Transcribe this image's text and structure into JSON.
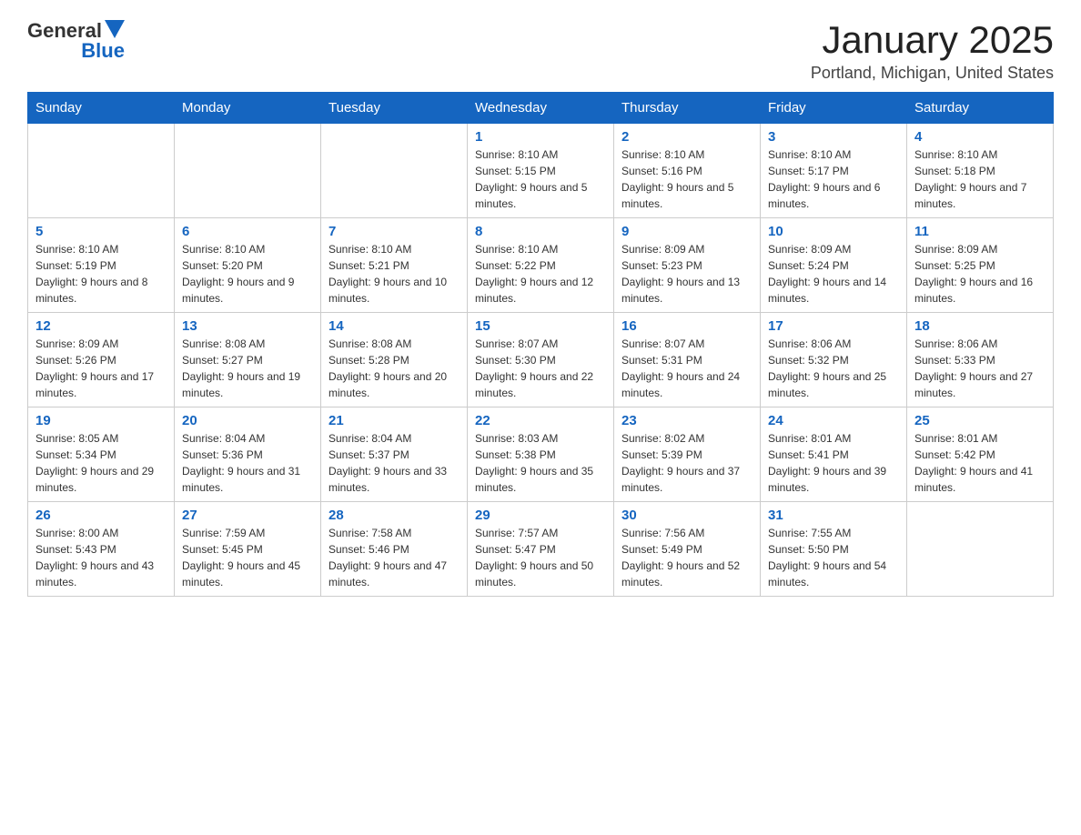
{
  "logo": {
    "text_general": "General",
    "text_blue": "Blue"
  },
  "header": {
    "month": "January 2025",
    "location": "Portland, Michigan, United States"
  },
  "weekdays": [
    "Sunday",
    "Monday",
    "Tuesday",
    "Wednesday",
    "Thursday",
    "Friday",
    "Saturday"
  ],
  "weeks": [
    [
      {
        "day": "",
        "info": ""
      },
      {
        "day": "",
        "info": ""
      },
      {
        "day": "",
        "info": ""
      },
      {
        "day": "1",
        "info": "Sunrise: 8:10 AM\nSunset: 5:15 PM\nDaylight: 9 hours and 5 minutes."
      },
      {
        "day": "2",
        "info": "Sunrise: 8:10 AM\nSunset: 5:16 PM\nDaylight: 9 hours and 5 minutes."
      },
      {
        "day": "3",
        "info": "Sunrise: 8:10 AM\nSunset: 5:17 PM\nDaylight: 9 hours and 6 minutes."
      },
      {
        "day": "4",
        "info": "Sunrise: 8:10 AM\nSunset: 5:18 PM\nDaylight: 9 hours and 7 minutes."
      }
    ],
    [
      {
        "day": "5",
        "info": "Sunrise: 8:10 AM\nSunset: 5:19 PM\nDaylight: 9 hours and 8 minutes."
      },
      {
        "day": "6",
        "info": "Sunrise: 8:10 AM\nSunset: 5:20 PM\nDaylight: 9 hours and 9 minutes."
      },
      {
        "day": "7",
        "info": "Sunrise: 8:10 AM\nSunset: 5:21 PM\nDaylight: 9 hours and 10 minutes."
      },
      {
        "day": "8",
        "info": "Sunrise: 8:10 AM\nSunset: 5:22 PM\nDaylight: 9 hours and 12 minutes."
      },
      {
        "day": "9",
        "info": "Sunrise: 8:09 AM\nSunset: 5:23 PM\nDaylight: 9 hours and 13 minutes."
      },
      {
        "day": "10",
        "info": "Sunrise: 8:09 AM\nSunset: 5:24 PM\nDaylight: 9 hours and 14 minutes."
      },
      {
        "day": "11",
        "info": "Sunrise: 8:09 AM\nSunset: 5:25 PM\nDaylight: 9 hours and 16 minutes."
      }
    ],
    [
      {
        "day": "12",
        "info": "Sunrise: 8:09 AM\nSunset: 5:26 PM\nDaylight: 9 hours and 17 minutes."
      },
      {
        "day": "13",
        "info": "Sunrise: 8:08 AM\nSunset: 5:27 PM\nDaylight: 9 hours and 19 minutes."
      },
      {
        "day": "14",
        "info": "Sunrise: 8:08 AM\nSunset: 5:28 PM\nDaylight: 9 hours and 20 minutes."
      },
      {
        "day": "15",
        "info": "Sunrise: 8:07 AM\nSunset: 5:30 PM\nDaylight: 9 hours and 22 minutes."
      },
      {
        "day": "16",
        "info": "Sunrise: 8:07 AM\nSunset: 5:31 PM\nDaylight: 9 hours and 24 minutes."
      },
      {
        "day": "17",
        "info": "Sunrise: 8:06 AM\nSunset: 5:32 PM\nDaylight: 9 hours and 25 minutes."
      },
      {
        "day": "18",
        "info": "Sunrise: 8:06 AM\nSunset: 5:33 PM\nDaylight: 9 hours and 27 minutes."
      }
    ],
    [
      {
        "day": "19",
        "info": "Sunrise: 8:05 AM\nSunset: 5:34 PM\nDaylight: 9 hours and 29 minutes."
      },
      {
        "day": "20",
        "info": "Sunrise: 8:04 AM\nSunset: 5:36 PM\nDaylight: 9 hours and 31 minutes."
      },
      {
        "day": "21",
        "info": "Sunrise: 8:04 AM\nSunset: 5:37 PM\nDaylight: 9 hours and 33 minutes."
      },
      {
        "day": "22",
        "info": "Sunrise: 8:03 AM\nSunset: 5:38 PM\nDaylight: 9 hours and 35 minutes."
      },
      {
        "day": "23",
        "info": "Sunrise: 8:02 AM\nSunset: 5:39 PM\nDaylight: 9 hours and 37 minutes."
      },
      {
        "day": "24",
        "info": "Sunrise: 8:01 AM\nSunset: 5:41 PM\nDaylight: 9 hours and 39 minutes."
      },
      {
        "day": "25",
        "info": "Sunrise: 8:01 AM\nSunset: 5:42 PM\nDaylight: 9 hours and 41 minutes."
      }
    ],
    [
      {
        "day": "26",
        "info": "Sunrise: 8:00 AM\nSunset: 5:43 PM\nDaylight: 9 hours and 43 minutes."
      },
      {
        "day": "27",
        "info": "Sunrise: 7:59 AM\nSunset: 5:45 PM\nDaylight: 9 hours and 45 minutes."
      },
      {
        "day": "28",
        "info": "Sunrise: 7:58 AM\nSunset: 5:46 PM\nDaylight: 9 hours and 47 minutes."
      },
      {
        "day": "29",
        "info": "Sunrise: 7:57 AM\nSunset: 5:47 PM\nDaylight: 9 hours and 50 minutes."
      },
      {
        "day": "30",
        "info": "Sunrise: 7:56 AM\nSunset: 5:49 PM\nDaylight: 9 hours and 52 minutes."
      },
      {
        "day": "31",
        "info": "Sunrise: 7:55 AM\nSunset: 5:50 PM\nDaylight: 9 hours and 54 minutes."
      },
      {
        "day": "",
        "info": ""
      }
    ]
  ]
}
